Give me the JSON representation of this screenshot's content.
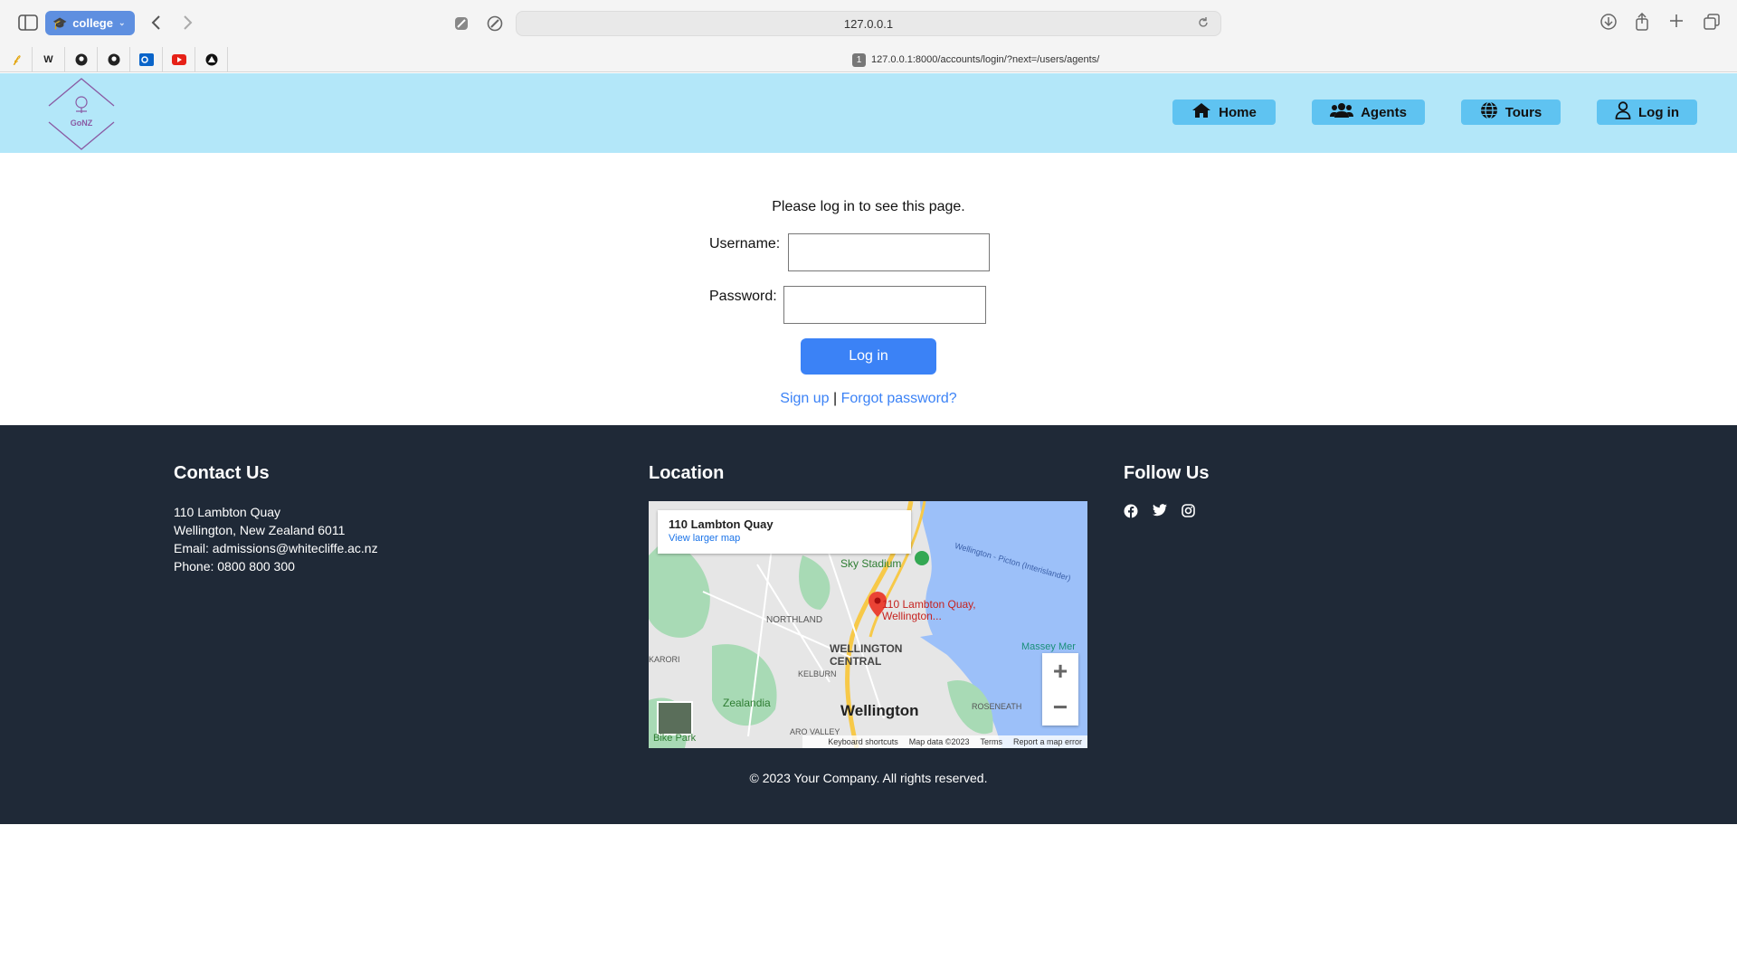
{
  "browser": {
    "tab_group": "college",
    "address": "127.0.0.1",
    "tab_number": "1",
    "tab_url": "127.0.0.1:8000/accounts/login/?next=/users/agents/",
    "favorites": [
      "fav-1",
      "W",
      "github",
      "github",
      "outlook",
      "youtube",
      "triangle"
    ]
  },
  "header": {
    "logo_text": "GoNZ",
    "nav": {
      "home": "Home",
      "agents": "Agents",
      "tours": "Tours",
      "login": "Log in"
    }
  },
  "login": {
    "message": "Please log in to see this page.",
    "username_label": "Username:",
    "password_label": "Password:",
    "username_value": "",
    "password_value": "",
    "submit_label": "Log in",
    "signup_link": "Sign up",
    "separator": "|",
    "forgot_link": "Forgot password?"
  },
  "footer": {
    "contact_heading": "Contact Us",
    "contact_lines": [
      "110 Lambton Quay",
      "Wellington, New Zealand 6011",
      "Email: admissions@whitecliffe.ac.nz",
      "Phone: 0800 800 300"
    ],
    "location_heading": "Location",
    "follow_heading": "Follow Us",
    "social": [
      "facebook-icon",
      "twitter-icon",
      "instagram-icon"
    ],
    "copyright": "© 2023 Your Company. All rights reserved."
  },
  "map": {
    "card_title": "110 Lambton Quay",
    "card_link": "View larger map",
    "labels": {
      "stadium": "Sky Stadium",
      "pin": "110 Lambton Quay, Wellington...",
      "northland": "NORTHLAND",
      "central": "WELLINGTON CENTRAL",
      "karori": "KARORI",
      "kelburn": "KELBURN",
      "zealandia": "Zealandia",
      "wellington": "Wellington",
      "roseneath": "ROSENEATH",
      "ferry": "Wellington - Picton (Interislander)",
      "massey": "Massey Mer",
      "aro": "ARO VALLEY",
      "bikepark": "Bike Park"
    },
    "attribution": {
      "shortcuts": "Keyboard shortcuts",
      "mapdata": "Map data ©2023",
      "terms": "Terms",
      "report": "Report a map error"
    },
    "colors": {
      "water": "#9cc0f9",
      "park": "#a8dab5",
      "land": "#e6e6e6",
      "road": "#f7c948"
    }
  },
  "colors": {
    "header_bg": "#b3e7f9",
    "nav_btn": "#5fc3f1",
    "primary": "#3b82f6",
    "footer_bg": "#1f2937"
  }
}
